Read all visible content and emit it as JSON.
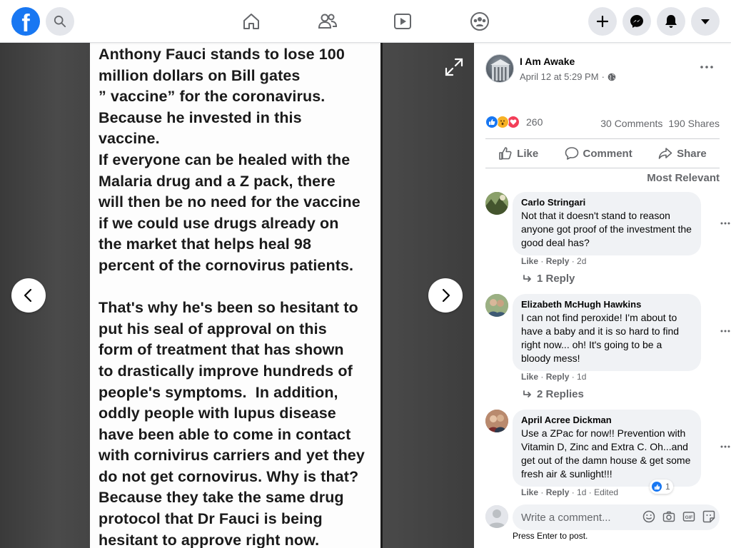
{
  "nav": {
    "logo_letter": "f",
    "search_icon": "search-icon",
    "center_icons": [
      "home-icon",
      "friends-icon",
      "watch-icon",
      "groups-icon"
    ],
    "right_icons": [
      "plus-icon",
      "messenger-icon",
      "notifications-icon",
      "account-menu-icon"
    ]
  },
  "photo": {
    "text": "Anthony Fauci stands to lose 100\nmillion dollars on Bill gates\n” vaccine” for the coronavirus.\nBecause he invested in this\nvaccine.\nIf everyone can be healed with the\nMalaria drug and a Z pack, there\nwill then be no need for the vaccine\nif we could use drugs already on\nthe market that helps heal 98\npercent of the cornovirus patients.\n\nThat's why he's been so hesitant to\nput his seal of approval on this\nform of treatment that has shown\nto drastically improve hundreds of\npeople's symptoms.  In addition,\noddly people with lupus disease\nhave been able to come in contact\nwith cornivirus carriers and yet they\ndo not get cornovirus. Why is that?\nBecause they take the same drug\nprotocol that Dr Fauci is being\nhesitant to approve right now."
  },
  "post": {
    "author": "I Am Awake",
    "date": "April 12 at 5:29 PM",
    "separator": "·",
    "reaction_count": "260",
    "comments_count": "30 Comments",
    "shares_count": "190 Shares",
    "actions": {
      "like": "Like",
      "comment": "Comment",
      "share": "Share"
    },
    "sort_label": "Most Relevant"
  },
  "comments": [
    {
      "name": "Carlo Stringari",
      "text": "Not that it doesn't stand to reason anyone got proof of the investment the good deal has?",
      "like": "Like",
      "reply": "Reply",
      "time": "2d",
      "replies": "1 Reply"
    },
    {
      "name": "Elizabeth McHugh Hawkins",
      "text": "I can not find peroxide! I'm about to have a baby and it is so hard to find right now... oh! It's going to be a bloody mess!",
      "like": "Like",
      "reply": "Reply",
      "time": "1d",
      "replies": "2 Replies"
    },
    {
      "name": "April Acree Dickman",
      "text": "Use a ZPac for now!! Prevention with Vitamin D, Zinc and Extra C. Oh...and get out of the damn house & get some fresh air & sunlight!!!",
      "like": "Like",
      "reply": "Reply",
      "time": "1d",
      "edited": "Edited",
      "like_count": "1"
    }
  ],
  "composer": {
    "placeholder": "Write a comment...",
    "hint": "Press Enter to post."
  },
  "colors": {
    "brand": "#1877f2",
    "secondary_text": "#65676b",
    "bubble": "#f0f2f5"
  }
}
